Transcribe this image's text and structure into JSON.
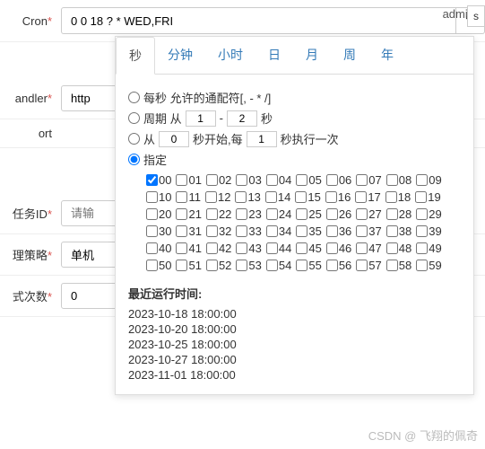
{
  "topRight": {
    "admin": "admin",
    "box": "s"
  },
  "cron": {
    "label": "Cron",
    "value": "0 0 18 ? * WED,FRI"
  },
  "handler": {
    "label": "andler",
    "value": "http"
  },
  "ort": {
    "label": "ort"
  },
  "taskId": {
    "label": "任务ID",
    "placeholder": "请输"
  },
  "strategy": {
    "label": "理策略",
    "value": "单机"
  },
  "retry": {
    "label": "式次数",
    "value": "0"
  },
  "popover": {
    "tabs": [
      "秒",
      "分钟",
      "小时",
      "日",
      "月",
      "周",
      "年"
    ],
    "activeTab": 0,
    "opt1": "每秒 允许的通配符[, - * /]",
    "opt2a": "周期 从",
    "opt2b": "-",
    "opt2c": "秒",
    "opt2v1": "1",
    "opt2v2": "2",
    "opt3a": "从",
    "opt3b": "秒开始,每",
    "opt3c": "秒执行一次",
    "opt3v1": "0",
    "opt3v2": "1",
    "opt4": "指定",
    "seconds": [
      "00",
      "01",
      "02",
      "03",
      "04",
      "05",
      "06",
      "07",
      "08",
      "09",
      "10",
      "11",
      "12",
      "13",
      "14",
      "15",
      "16",
      "17",
      "18",
      "19",
      "20",
      "21",
      "22",
      "23",
      "24",
      "25",
      "26",
      "27",
      "28",
      "29",
      "30",
      "31",
      "32",
      "33",
      "34",
      "35",
      "36",
      "37",
      "38",
      "39",
      "40",
      "41",
      "42",
      "43",
      "44",
      "45",
      "46",
      "47",
      "48",
      "49",
      "50",
      "51",
      "52",
      "53",
      "54",
      "55",
      "56",
      "57",
      "58",
      "59"
    ],
    "checked": [
      "00"
    ],
    "recentTitle": "最近运行时间:",
    "recentTimes": [
      "2023-10-18 18:00:00",
      "2023-10-20 18:00:00",
      "2023-10-25 18:00:00",
      "2023-10-27 18:00:00",
      "2023-11-01 18:00:00"
    ]
  },
  "watermark": "CSDN @ 飞翔的佩奇"
}
